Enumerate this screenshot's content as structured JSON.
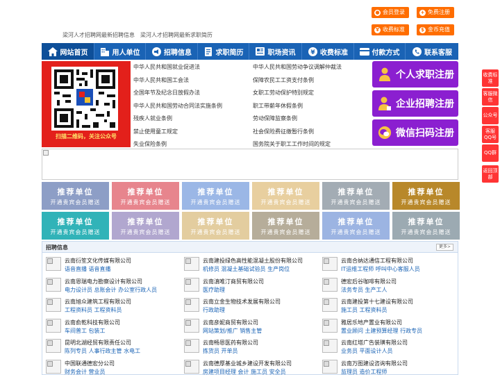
{
  "top_buttons": [
    {
      "label": "会员登录",
      "icon": "user-icon",
      "color": "#ff6d00"
    },
    {
      "label": "免费注册",
      "icon": "user-add-icon",
      "color": "#ff6d00"
    },
    {
      "label": "收费标准",
      "icon": "yen-icon",
      "color": "#ff6d00"
    },
    {
      "label": "金币充值",
      "icon": "coin-icon",
      "color": "#ff6d00"
    }
  ],
  "taglines": [
    "梁河人才招聘网最新招聘信息",
    "梁河人才招聘网最新求职简历"
  ],
  "nav": [
    {
      "label": "网站首页",
      "icon": "home-icon"
    },
    {
      "label": "用人单位",
      "icon": "building-icon"
    },
    {
      "label": "招聘信息",
      "icon": "megaphone-icon"
    },
    {
      "label": "求职简历",
      "icon": "resume-icon"
    },
    {
      "label": "职场资讯",
      "icon": "news-icon"
    },
    {
      "label": "收费标准",
      "icon": "yen-icon"
    },
    {
      "label": "付款方式",
      "icon": "card-icon"
    },
    {
      "label": "联系客服",
      "icon": "phone-icon"
    }
  ],
  "qr": {
    "caption": "扫描二维码，关注公众号"
  },
  "links_left": [
    "中华人民共和国就业促进法",
    "中华人民共和国工会法",
    "全国年节及纪念日放假办法",
    "中华人民共和国劳动合同法实施条例",
    "残疾人就业条例",
    "禁止使用童工规定",
    "失业保险条例"
  ],
  "links_right": [
    "中华人民共和国劳动争议调解仲裁法",
    "保障农民工工资支付条例",
    "女职工劳动保护特别规定",
    "职工带薪年休假条例",
    "劳动保障监察条例",
    "社会保险费征缴暂行条例",
    "国务院关于职工工作时间的规定"
  ],
  "register_buttons": [
    {
      "label": "个人求职注册",
      "icon": "person-icon"
    },
    {
      "label": "企业招聘注册",
      "icon": "enterprise-icon"
    },
    {
      "label": "微信扫码注册",
      "icon": "wechat-icon"
    }
  ],
  "tiles": {
    "title": "推荐单位",
    "subtitle": "开通贵宾会员赠送",
    "colors": [
      "#8d9ec6",
      "#e7858d",
      "#9bb7e6",
      "#e8cf9f",
      "#a3acb4",
      "#b8882a",
      "#31b3b8",
      "#b1a7cf",
      "#e3cd9f",
      "#b6ad9a",
      "#9cb4e2",
      "#9caab2",
      "#c3a995"
    ]
  },
  "jobs_section": {
    "title": "招聘信息",
    "more": "更多>"
  },
  "jobs": [
    {
      "company": "云南衍笙文化传媒有限公司",
      "positions": "语音直播 语音直播"
    },
    {
      "company": "云南建投绿色高性能混凝土股份有限公司",
      "positions": "机修员 混凝土基础试验员 生产岗位"
    },
    {
      "company": "云南合纳达通信工程有限公司",
      "positions": "IT运维工程师 呼叫中心客服人员"
    },
    {
      "company": "云南恩瑞电力勘察设计有限公司",
      "positions": "电力设计员 总账会计 办公室行政人员"
    },
    {
      "company": "云南滇唯汀商贸有限公司",
      "positions": "医疗助理"
    },
    {
      "company": "德宏后谷咖啡有限公司",
      "positions": "法务专员 生产工人"
    },
    {
      "company": "云南旭众建筑工程有限公司",
      "positions": "工程资料员 工程资料员"
    },
    {
      "company": "云南立金生物技术发展有限公司",
      "positions": "行政助理"
    },
    {
      "company": "云南建投第十七建设有限公司",
      "positions": "施工员 工程资料员"
    },
    {
      "company": "云南俞乾科技有限公司",
      "positions": "车间普工 包装工"
    },
    {
      "company": "云南彦妮商贸有限公司",
      "positions": "网站策划/推广 销售主管"
    },
    {
      "company": "雅居乐地产置业有限公司",
      "positions": "置业顾问 土建预算经理 行政专员"
    },
    {
      "company": "昆明北湖经贸有限责任公司",
      "positions": "陈列专员 人事行政主管 水电工"
    },
    {
      "company": "云南畅恩医药有限公司",
      "positions": "拣货员 开单员"
    },
    {
      "company": "云南红塔广告装璜有限公司",
      "positions": "业务员 平面设计人员"
    },
    {
      "company": "中国联通德宏分公司",
      "positions": "财务会计 营业员"
    },
    {
      "company": "云南德厚基业城乡建设开发有限公司",
      "positions": "房建项目经理 会计 施工员 安全员"
    },
    {
      "company": "云南万图建设咨询有限公司",
      "positions": "监理员 造价工程师"
    }
  ],
  "side_float": [
    "收费标准",
    "客服微信",
    "公众号",
    "客服QQ号",
    "QQ群",
    "返回顶部"
  ]
}
